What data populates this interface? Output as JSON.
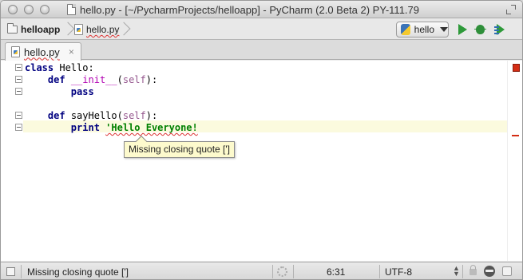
{
  "window": {
    "title": "hello.py - [~/PycharmProjects/helloapp] - PyCharm (2.0 Beta 2) PY-111.79"
  },
  "navbar": {
    "breadcrumbs": [
      "helloapp",
      "hello.py"
    ],
    "run_config": "hello"
  },
  "tabs": [
    {
      "label": "hello.py",
      "close": "×"
    }
  ],
  "editor": {
    "lines": [
      {
        "kw": "class",
        "rest": " Hello:"
      },
      {
        "indent": "    ",
        "kw": "def",
        "sp": " ",
        "name": "__init__",
        "open": "(",
        "param": "self",
        "close": "):"
      },
      {
        "indent": "        ",
        "kw": "pass"
      },
      {
        "blank": ""
      },
      {
        "indent": "    ",
        "kw": "def",
        "rest": " sayHello(",
        "param": "self",
        "close": "):"
      },
      {
        "indent": "        ",
        "kw": "print",
        "sp": " ",
        "str": "'Hello Everyone!"
      }
    ],
    "tooltip": "Missing closing quote [']"
  },
  "status": {
    "message": "Missing closing quote [']",
    "caret": "6:31",
    "encoding": "UTF-8"
  },
  "colors": {
    "keyword": "#000080",
    "magic_method": "#b200b2",
    "self_param": "#94558d",
    "string": "#008000",
    "error_marker": "#d42d14",
    "current_line": "#fbfade",
    "tooltip_bg": "#fdfacd"
  },
  "icons": {
    "traffic_lights": [
      "close-icon",
      "minimize-icon",
      "zoom-icon"
    ],
    "toolbar": [
      "run-icon",
      "debug-icon",
      "run-with-coverage-icon"
    ],
    "statusbar": [
      "toggle-tool-windows-icon",
      "background-tasks-icon",
      "lock-icon",
      "inspector-icon",
      "event-log-icon"
    ]
  }
}
